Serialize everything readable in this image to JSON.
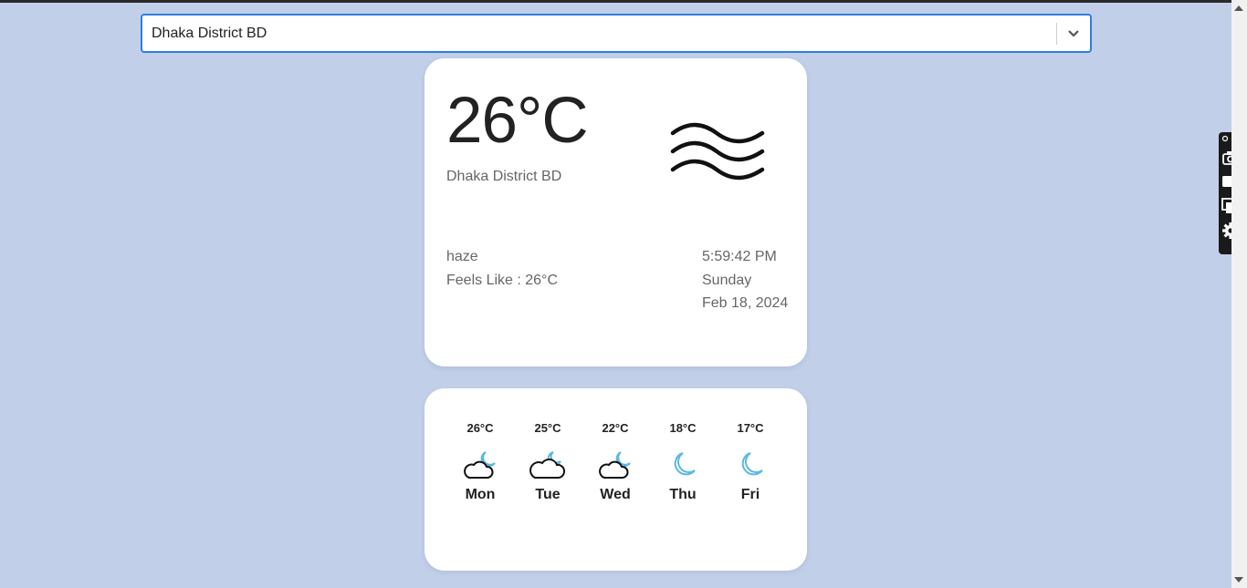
{
  "search": {
    "value": "Dhaka District BD"
  },
  "current": {
    "temperature": "26°C",
    "location": "Dhaka District BD",
    "condition": "haze",
    "feels_like": "Feels Like : 26°C",
    "time": "5:59:42 PM",
    "weekday": "Sunday",
    "date": "Feb 18, 2024",
    "icon": "haze-icon"
  },
  "forecast": [
    {
      "temp": "26°C",
      "day": "Mon",
      "icon": "cloudy-night-icon"
    },
    {
      "temp": "25°C",
      "day": "Tue",
      "icon": "cloudy-night-icon"
    },
    {
      "temp": "22°C",
      "day": "Wed",
      "icon": "cloudy-night-icon"
    },
    {
      "temp": "18°C",
      "day": "Thu",
      "icon": "moon-icon"
    },
    {
      "temp": "17°C",
      "day": "Fri",
      "icon": "moon-icon"
    }
  ],
  "colors": {
    "background": "#c1cfe9",
    "accent": "#2f7de1",
    "moon": "#5bb8e3"
  }
}
